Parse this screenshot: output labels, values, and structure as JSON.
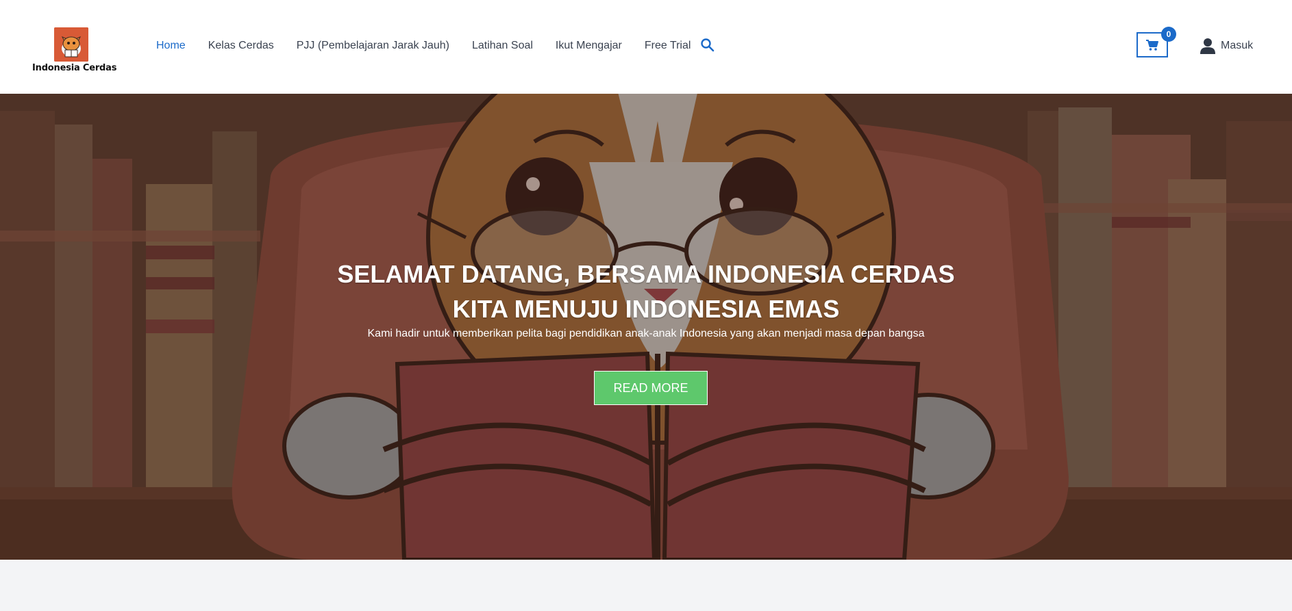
{
  "brand": {
    "name": "Indonesia Cerdas",
    "logo_icon": "cat-reading-icon"
  },
  "nav": {
    "items": [
      {
        "label": "Home",
        "active": true
      },
      {
        "label": "Kelas Cerdas",
        "active": false
      },
      {
        "label": "PJJ (Pembelajaran Jarak Jauh)",
        "active": false
      },
      {
        "label": "Latihan Soal",
        "active": false
      },
      {
        "label": "Ikut Mengajar",
        "active": false
      },
      {
        "label": "Free Trial",
        "active": false
      }
    ],
    "search_icon": "search-icon"
  },
  "cart": {
    "count": "0",
    "icon": "cart-icon"
  },
  "account": {
    "label": "Masuk",
    "icon": "user-icon"
  },
  "hero": {
    "title_line1": "SELAMAT DATANG, BERSAMA INDONESIA CERDAS",
    "title_line2": "KITA MENUJU INDONESIA EMAS",
    "subtitle": "Kami hadir untuk memberikan pelita bagi pendidikan anak-anak Indonesia yang akan menjadi masa depan bangsa",
    "cta_label": "READ MORE"
  },
  "colors": {
    "accent": "#1b6ac9",
    "cta": "#5ec86c",
    "nav_text": "#3a4250"
  }
}
